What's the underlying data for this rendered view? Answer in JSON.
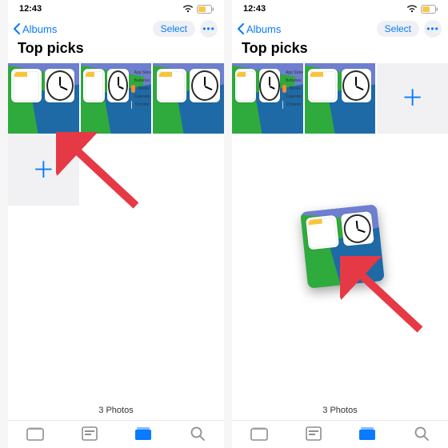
{
  "status": {
    "time": "12:43"
  },
  "nav": {
    "back_label": "Albums",
    "select_label": "Select"
  },
  "page": {
    "title": "Top picks"
  },
  "footer": {
    "count_label": "3 Photos"
  },
  "apps_list": [
    {
      "label": "App Store",
      "color": "#1f86ff"
    },
    {
      "label": "Batteries",
      "color": "#3fbf55"
    },
    {
      "label": "Books",
      "color": "#ff8a2b"
    },
    {
      "label": "Calendar",
      "color": "#ff4357"
    },
    {
      "label": "Chrome",
      "color": "#d4d4d4"
    }
  ],
  "icons": {
    "chevron_left": "chevron-left-icon",
    "more": "more-icon",
    "wifi": "wifi-icon",
    "battery": "battery-icon",
    "plus": "plus-icon",
    "arrow": "arrow-icon",
    "tab_library": "library-tab-icon",
    "tab_foryou": "foryou-tab-icon",
    "tab_albums": "albums-tab-icon",
    "tab_search": "search-tab-icon"
  }
}
